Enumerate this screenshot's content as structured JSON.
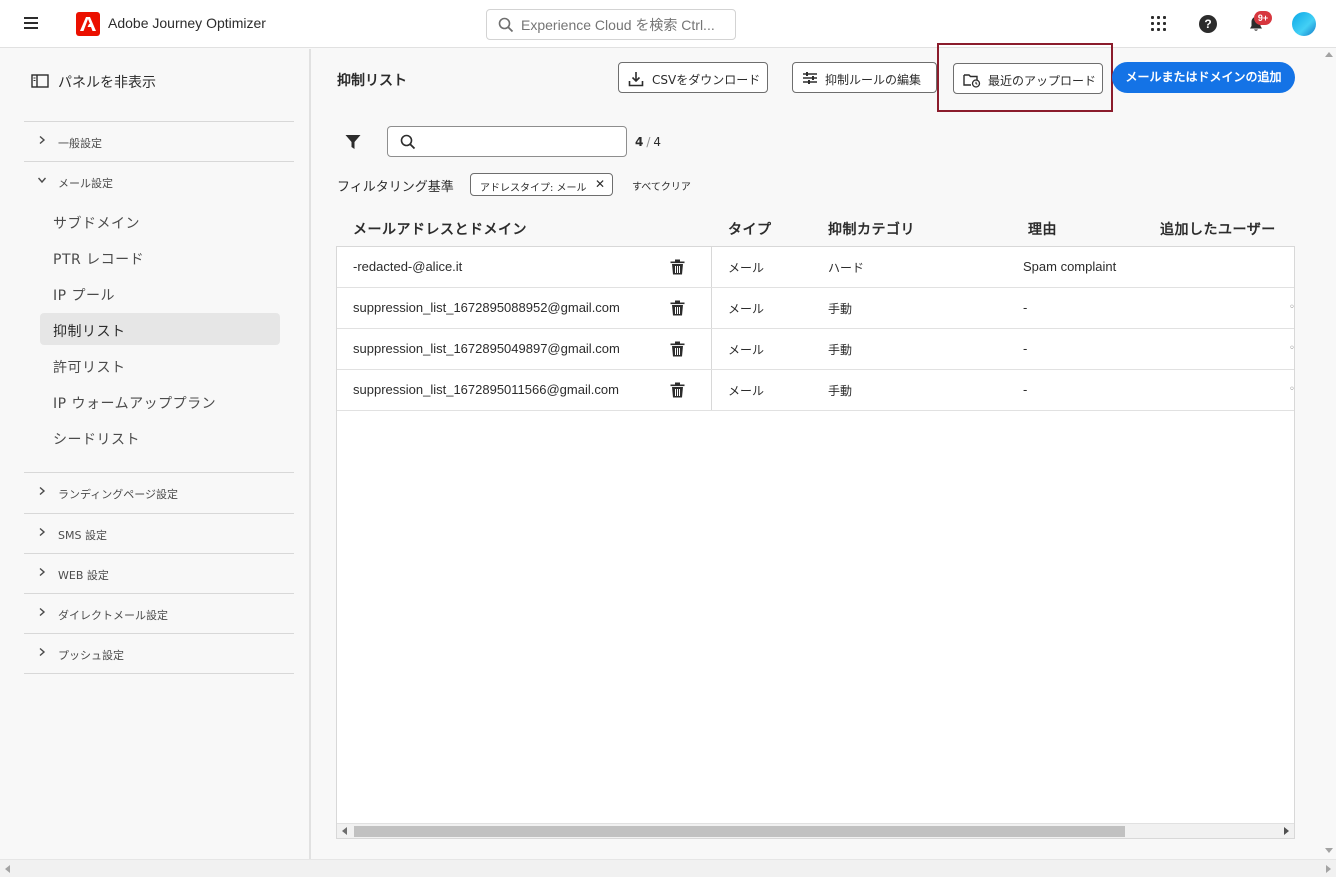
{
  "header": {
    "app_title": "Adobe Journey Optimizer",
    "search_placeholder": "Experience Cloud を検索 Ctrl...",
    "notification_badge": "9+",
    "icons": [
      "menu-icon",
      "adobe-logo-icon",
      "search-icon",
      "apps-grid-icon",
      "help-icon",
      "bell-icon",
      "avatar"
    ]
  },
  "sidebar": {
    "toggle_label": "パネルを非表示",
    "sections": [
      {
        "label": "一般設定",
        "expanded": false
      },
      {
        "label": "メール設定",
        "expanded": true
      },
      {
        "label": "ランディングページ設定",
        "expanded": false
      },
      {
        "label": "SMS 設定",
        "expanded": false
      },
      {
        "label": "WEB 設定",
        "expanded": false
      },
      {
        "label": "ダイレクトメール設定",
        "expanded": false
      },
      {
        "label": "プッシュ設定",
        "expanded": false
      }
    ],
    "email_items": [
      {
        "label": "サブドメイン"
      },
      {
        "label": "PTR レコード"
      },
      {
        "label": "IP プール"
      },
      {
        "label": "抑制リスト",
        "active": true
      },
      {
        "label": "許可リスト"
      },
      {
        "label": "IP ウォームアッププラン"
      },
      {
        "label": "シードリスト"
      }
    ]
  },
  "main": {
    "title": "抑制リスト",
    "buttons": {
      "download_csv": "CSVをダウンロード",
      "edit_rules": "抑制ルールの編集",
      "recent_uploads": "最近のアップロード",
      "add_email_domain": "メールまたはドメインの追加"
    },
    "search": {
      "value": "",
      "placeholder": ""
    },
    "count": {
      "shown": "4",
      "total": "4"
    },
    "filter_label": "フィルタリング基準",
    "active_filter": "アドレスタイプ: メール",
    "clear_all": "すべてクリア",
    "columns": [
      "メールアドレスとドメイン",
      "タイプ",
      "抑制カテゴリ",
      "理由",
      "追加したユーザー"
    ],
    "rows": [
      {
        "address": "-redacted-@alice.it",
        "type": "メール",
        "category": "ハード",
        "reason": "Spam complaint"
      },
      {
        "address": "suppression_list_1672895088952@gmail.com",
        "type": "メール",
        "category": "手動",
        "reason": "-"
      },
      {
        "address": "suppression_list_1672895049897@gmail.com",
        "type": "メール",
        "category": "手動",
        "reason": "-"
      },
      {
        "address": "suppression_list_1672895011566@gmail.com",
        "type": "メール",
        "category": "手動",
        "reason": "-"
      }
    ]
  },
  "colors": {
    "accent": "#1473e6",
    "adobe_red": "#eb1000",
    "highlight_border": "#8b1c2c",
    "badge_red": "#d7373f"
  }
}
